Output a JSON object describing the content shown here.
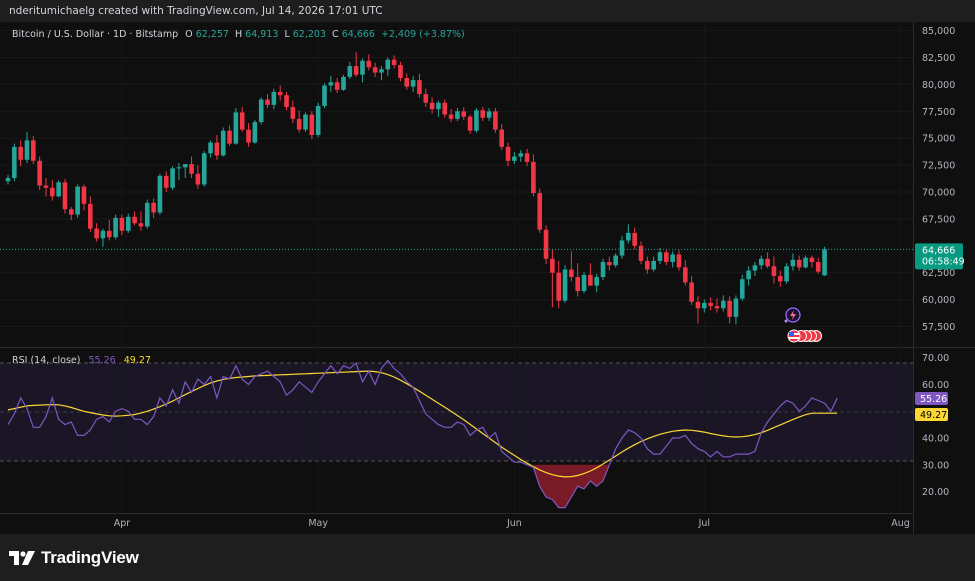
{
  "header": {
    "attribution": "nderitumichaelg created with TradingView.com, Jul 14, 2026 17:01 UTC"
  },
  "legend": {
    "symbol": "Bitcoin / U.S. Dollar · 1D · Bitstamp",
    "o_label": "O",
    "o_value": "62,257",
    "h_label": "H",
    "h_value": "64,913",
    "l_label": "L",
    "l_value": "62,203",
    "c_label": "C",
    "c_value": "64,666",
    "change": "+2,409 (+3.87%)"
  },
  "price_badge": {
    "price": "64,666",
    "countdown": "06:58:49"
  },
  "rsi_legend": {
    "label": "RSI (14, close)",
    "rsi_value": "55.26",
    "ma_value": "49.27"
  },
  "rsi_badges": {
    "rsi": "55.26",
    "ma": "49.27"
  },
  "footer": {
    "brand": "TradingView"
  },
  "colors": {
    "up": "#26a69a",
    "down": "#f23645",
    "rsi": "#7e57c2",
    "rsi_ma": "#fdd835",
    "badge_green": "#089981",
    "badge_purple": "#7e57c2",
    "badge_yellow": "#fdd835"
  },
  "chart_data": [
    {
      "type": "candlestick",
      "title": "Bitcoin / U.S. Dollar · 1D · Bitstamp",
      "y_ticks": [
        "85,000",
        "82,500",
        "80,000",
        "77,500",
        "75,000",
        "72,500",
        "70,000",
        "67,500",
        "62,500",
        "60,000",
        "57,500"
      ],
      "x_ticks": [
        "Apr",
        "May",
        "Jun",
        "Jul",
        "Aug"
      ],
      "ylim": [
        55600,
        85800
      ],
      "last_price": 64666,
      "candles": [
        [
          71000,
          71600,
          70700,
          71300
        ],
        [
          71300,
          74500,
          71000,
          74200
        ],
        [
          74200,
          74800,
          72400,
          73000
        ],
        [
          73000,
          75600,
          72700,
          74800
        ],
        [
          74800,
          75200,
          72600,
          72900
        ],
        [
          72900,
          73300,
          70200,
          70600
        ],
        [
          70600,
          71300,
          69600,
          70400
        ],
        [
          70400,
          71100,
          69200,
          69600
        ],
        [
          69600,
          71100,
          69500,
          70900
        ],
        [
          70900,
          71200,
          68000,
          68400
        ],
        [
          68400,
          68600,
          67400,
          67900
        ],
        [
          67900,
          70700,
          67600,
          70500
        ],
        [
          70500,
          70700,
          68300,
          68900
        ],
        [
          68900,
          69600,
          66300,
          66600
        ],
        [
          66600,
          67100,
          65400,
          65700
        ],
        [
          65700,
          66600,
          64900,
          66400
        ],
        [
          66400,
          67400,
          65500,
          65800
        ],
        [
          65800,
          67900,
          65600,
          67600
        ],
        [
          67600,
          67900,
          66000,
          66400
        ],
        [
          66400,
          68000,
          66200,
          67700
        ],
        [
          67700,
          68200,
          66900,
          67100
        ],
        [
          67100,
          68200,
          66400,
          66800
        ],
        [
          66800,
          69300,
          66600,
          69000
        ],
        [
          69000,
          69400,
          67600,
          68100
        ],
        [
          68100,
          71700,
          67900,
          71500
        ],
        [
          71500,
          71900,
          70000,
          70400
        ],
        [
          70400,
          72400,
          70200,
          72200
        ],
        [
          72200,
          72700,
          71100,
          72300
        ],
        [
          72300,
          72600,
          71300,
          72600
        ],
        [
          72600,
          73300,
          71300,
          71700
        ],
        [
          71700,
          72500,
          70300,
          70700
        ],
        [
          70700,
          73800,
          70500,
          73600
        ],
        [
          73600,
          74800,
          73200,
          74600
        ],
        [
          74600,
          75300,
          73000,
          73400
        ],
        [
          73400,
          76000,
          73300,
          75700
        ],
        [
          75700,
          76200,
          74300,
          74500
        ],
        [
          74500,
          77800,
          74400,
          77400
        ],
        [
          77400,
          77900,
          75600,
          75800
        ],
        [
          75800,
          76400,
          74200,
          74600
        ],
        [
          74600,
          76700,
          74500,
          76500
        ],
        [
          76500,
          78800,
          76300,
          78600
        ],
        [
          78600,
          79100,
          77800,
          78100
        ],
        [
          78100,
          79600,
          77700,
          79300
        ],
        [
          79300,
          79900,
          78500,
          79000
        ],
        [
          79000,
          79300,
          77600,
          77900
        ],
        [
          77900,
          78500,
          76400,
          76800
        ],
        [
          76800,
          77600,
          75500,
          75800
        ],
        [
          75800,
          77400,
          75600,
          77200
        ],
        [
          77200,
          77500,
          74900,
          75300
        ],
        [
          75300,
          78300,
          75100,
          78000
        ],
        [
          78000,
          80100,
          77800,
          79900
        ],
        [
          79900,
          80800,
          79300,
          80200
        ],
        [
          80200,
          80600,
          79200,
          79500
        ],
        [
          79500,
          80900,
          79400,
          80700
        ],
        [
          80700,
          82100,
          80500,
          81700
        ],
        [
          81700,
          83000,
          80700,
          80900
        ],
        [
          80900,
          82400,
          80200,
          82200
        ],
        [
          82200,
          82800,
          81300,
          81600
        ],
        [
          81600,
          82000,
          80700,
          81100
        ],
        [
          81100,
          81700,
          80400,
          81400
        ],
        [
          81400,
          82500,
          80800,
          82300
        ],
        [
          82300,
          82700,
          81500,
          81800
        ],
        [
          81800,
          82100,
          80300,
          80600
        ],
        [
          80600,
          81000,
          79500,
          79800
        ],
        [
          79800,
          80800,
          79300,
          80400
        ],
        [
          80400,
          81000,
          78800,
          79100
        ],
        [
          79100,
          79600,
          77900,
          78300
        ],
        [
          78300,
          78800,
          77300,
          77700
        ],
        [
          77700,
          78500,
          77000,
          78300
        ],
        [
          78300,
          78600,
          76900,
          77200
        ],
        [
          77200,
          77700,
          76500,
          76800
        ],
        [
          76800,
          77800,
          76600,
          77500
        ],
        [
          77500,
          77900,
          76700,
          77000
        ],
        [
          77000,
          77200,
          75400,
          75700
        ],
        [
          75700,
          77800,
          75500,
          77600
        ],
        [
          77600,
          77900,
          76600,
          76900
        ],
        [
          76900,
          77800,
          76600,
          77500
        ],
        [
          77500,
          77800,
          75500,
          75800
        ],
        [
          75800,
          76300,
          73900,
          74200
        ],
        [
          74200,
          74600,
          72400,
          72900
        ],
        [
          72900,
          73700,
          72600,
          73300
        ],
        [
          73300,
          73900,
          72800,
          73600
        ],
        [
          73600,
          74000,
          72400,
          72800
        ],
        [
          72800,
          73500,
          69600,
          69900
        ],
        [
          69900,
          70300,
          66200,
          66500
        ],
        [
          66500,
          66900,
          63300,
          63800
        ],
        [
          63800,
          64700,
          59300,
          62500
        ],
        [
          62500,
          63600,
          59200,
          59900
        ],
        [
          59900,
          63200,
          59700,
          62800
        ],
        [
          62800,
          64500,
          61700,
          62100
        ],
        [
          62100,
          63400,
          60300,
          60800
        ],
        [
          60800,
          62600,
          60600,
          62300
        ],
        [
          62300,
          63400,
          61700,
          61300
        ],
        [
          61300,
          62400,
          60700,
          62100
        ],
        [
          62100,
          63800,
          61800,
          63500
        ],
        [
          63500,
          64000,
          62700,
          63200
        ],
        [
          63200,
          64300,
          63000,
          64100
        ],
        [
          64100,
          65900,
          63800,
          65500
        ],
        [
          65500,
          67000,
          65200,
          66200
        ],
        [
          66200,
          66700,
          64700,
          65000
        ],
        [
          65000,
          65400,
          63300,
          63600
        ],
        [
          63600,
          64000,
          62400,
          62800
        ],
        [
          62800,
          64000,
          62600,
          63600
        ],
        [
          63600,
          64800,
          63300,
          64400
        ],
        [
          64400,
          64600,
          63200,
          63500
        ],
        [
          63500,
          64500,
          63000,
          64200
        ],
        [
          64200,
          64600,
          62700,
          63000
        ],
        [
          63000,
          63700,
          61300,
          61600
        ],
        [
          61600,
          62200,
          59500,
          59800
        ],
        [
          59800,
          60300,
          57800,
          59200
        ],
        [
          59200,
          60000,
          58800,
          59700
        ],
        [
          59700,
          60200,
          59000,
          59400
        ],
        [
          59400,
          60100,
          58800,
          59200
        ],
        [
          59200,
          60400,
          58900,
          59900
        ],
        [
          59900,
          60300,
          57800,
          58400
        ],
        [
          58400,
          60400,
          57700,
          60100
        ],
        [
          60100,
          62300,
          59900,
          61900
        ],
        [
          61900,
          63100,
          61300,
          62700
        ],
        [
          62700,
          63500,
          62200,
          63200
        ],
        [
          63200,
          64100,
          62800,
          63800
        ],
        [
          63800,
          64400,
          62900,
          63100
        ],
        [
          63100,
          64000,
          61500,
          62200
        ],
        [
          62200,
          62700,
          61200,
          61700
        ],
        [
          61700,
          63400,
          61500,
          63100
        ],
        [
          63100,
          64300,
          62700,
          63700
        ],
        [
          63700,
          64100,
          62700,
          63000
        ],
        [
          63000,
          64100,
          62900,
          63900
        ],
        [
          63900,
          64100,
          63000,
          63500
        ],
        [
          63500,
          63900,
          62400,
          62600
        ],
        [
          62257,
          64913,
          62203,
          64666
        ]
      ]
    },
    {
      "type": "line",
      "title": "RSI (14, close)",
      "y_ticks": [
        "70.00",
        "60.00",
        "40.00",
        "30.00",
        "20.00"
      ],
      "ylim": [
        12,
        74
      ],
      "bands": [
        30,
        50,
        70
      ],
      "series": [
        {
          "name": "RSI",
          "values": [
            45,
            49,
            55,
            51,
            44,
            44,
            48,
            55,
            47,
            45,
            46,
            41,
            41,
            43,
            47,
            48,
            46,
            50,
            51,
            50,
            47,
            47,
            45,
            48,
            55,
            52,
            58,
            53,
            61,
            57,
            62,
            60,
            63,
            55,
            63,
            62,
            67,
            62,
            60,
            63,
            64,
            65,
            63,
            61,
            56,
            58,
            61,
            59,
            57,
            61,
            64,
            67,
            64,
            67,
            66,
            68,
            61,
            65,
            60,
            66,
            69,
            66,
            64,
            61,
            59,
            54,
            49,
            47,
            45,
            44,
            44,
            46,
            45,
            41,
            43,
            44,
            40,
            42,
            35,
            33,
            31,
            31,
            30,
            29,
            22,
            18,
            17,
            14,
            14,
            18,
            22,
            21,
            24,
            22,
            24,
            30,
            36,
            40,
            43,
            42,
            40,
            36,
            34,
            34,
            37,
            40,
            40,
            41,
            38,
            36,
            35,
            33,
            35,
            33,
            33,
            34,
            34,
            34,
            35,
            42,
            46,
            49,
            52,
            54,
            53,
            50,
            52,
            55,
            54,
            53,
            50,
            55
          ]
        },
        {
          "name": "RSI MA",
          "values": [
            50.5,
            51.0,
            51.5,
            52.0,
            52.2,
            52.3,
            52.4,
            52.5,
            52.4,
            52.0,
            51.4,
            50.7,
            50.0,
            49.5,
            49.0,
            48.6,
            48.3,
            48.2,
            48.3,
            48.5,
            48.8,
            49.3,
            50.0,
            50.8,
            51.7,
            52.7,
            53.8,
            55.0,
            56.2,
            57.4,
            58.5,
            59.6,
            60.6,
            61.3,
            61.9,
            62.3,
            62.6,
            62.8,
            63.0,
            63.2,
            63.3,
            63.4,
            63.5,
            63.6,
            63.7,
            63.8,
            63.9,
            64.0,
            64.1,
            64.2,
            64.3,
            64.4,
            64.5,
            64.6,
            64.7,
            64.8,
            64.9,
            65.0,
            64.8,
            64.4,
            63.7,
            62.8,
            61.6,
            60.3,
            58.9,
            57.5,
            56.0,
            54.5,
            53.0,
            51.5,
            50.0,
            48.4,
            46.8,
            45.1,
            43.4,
            41.7,
            40.0,
            38.3,
            36.6,
            35.0,
            33.5,
            32.0,
            30.6,
            29.3,
            28.1,
            27.1,
            26.3,
            25.8,
            25.5,
            25.6,
            26.0,
            26.7,
            27.7,
            28.9,
            30.3,
            31.8,
            33.3,
            34.8,
            36.2,
            37.5,
            38.7,
            39.7,
            40.6,
            41.4,
            42.0,
            42.5,
            42.8,
            43.0,
            42.9,
            42.6,
            42.2,
            41.7,
            41.2,
            40.8,
            40.5,
            40.4,
            40.5,
            40.8,
            41.3,
            42.0,
            42.9,
            43.9,
            44.9,
            45.9,
            46.9,
            47.9,
            48.7,
            49.27,
            49.27,
            49.27,
            49.27,
            49.27
          ]
        }
      ]
    }
  ]
}
